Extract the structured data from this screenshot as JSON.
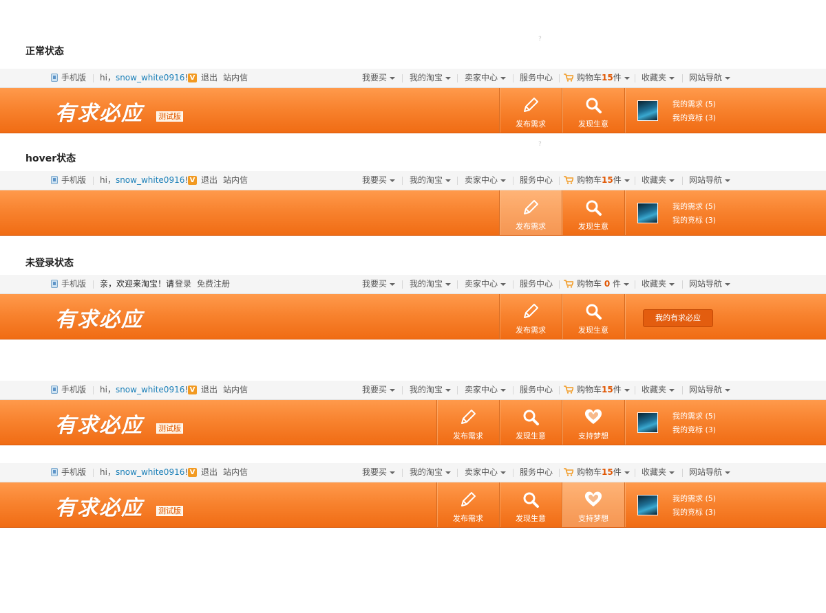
{
  "labels": {
    "normal": "正常状态",
    "hover": "hover状态",
    "logged_out": "未登录状态",
    "qmark": "?"
  },
  "topbar": {
    "mobile": "手机版",
    "hi": "hi，",
    "username": "snow_white0916",
    "bang": "!",
    "exit_icon": "V",
    "logout": "退出",
    "messages": "站内信",
    "welcome": "亲，欢迎来淘宝！请",
    "login": "登录",
    "register": "免费注册",
    "buy": "我要买",
    "my_taobao": "我的淘宝",
    "seller": "卖家中心",
    "service": "服务中心",
    "cart_prefix": "购物车",
    "cart_count": "15",
    "cart_zero": "0",
    "cart_suffix": "件",
    "favorites": "收藏夹",
    "site_nav": "网站导航"
  },
  "banner": {
    "logo": "有求必应",
    "beta": "测试版",
    "publish": "发布需求",
    "discover": "发现生意",
    "support": "支持梦想",
    "my_needs": "我的需求 (5)",
    "my_bids": "我的竞标 (3)",
    "my_center": "我的有求必应"
  },
  "colors": {
    "orange_top": "#ff9a4c",
    "orange_bottom": "#f06c14",
    "link_blue": "#1a7fb8",
    "cart_count": "#e05500"
  },
  "icons": [
    "phone-icon",
    "exit-icon",
    "cart-icon",
    "pencil-icon",
    "magnifier-icon",
    "heart-icon",
    "avatar"
  ]
}
